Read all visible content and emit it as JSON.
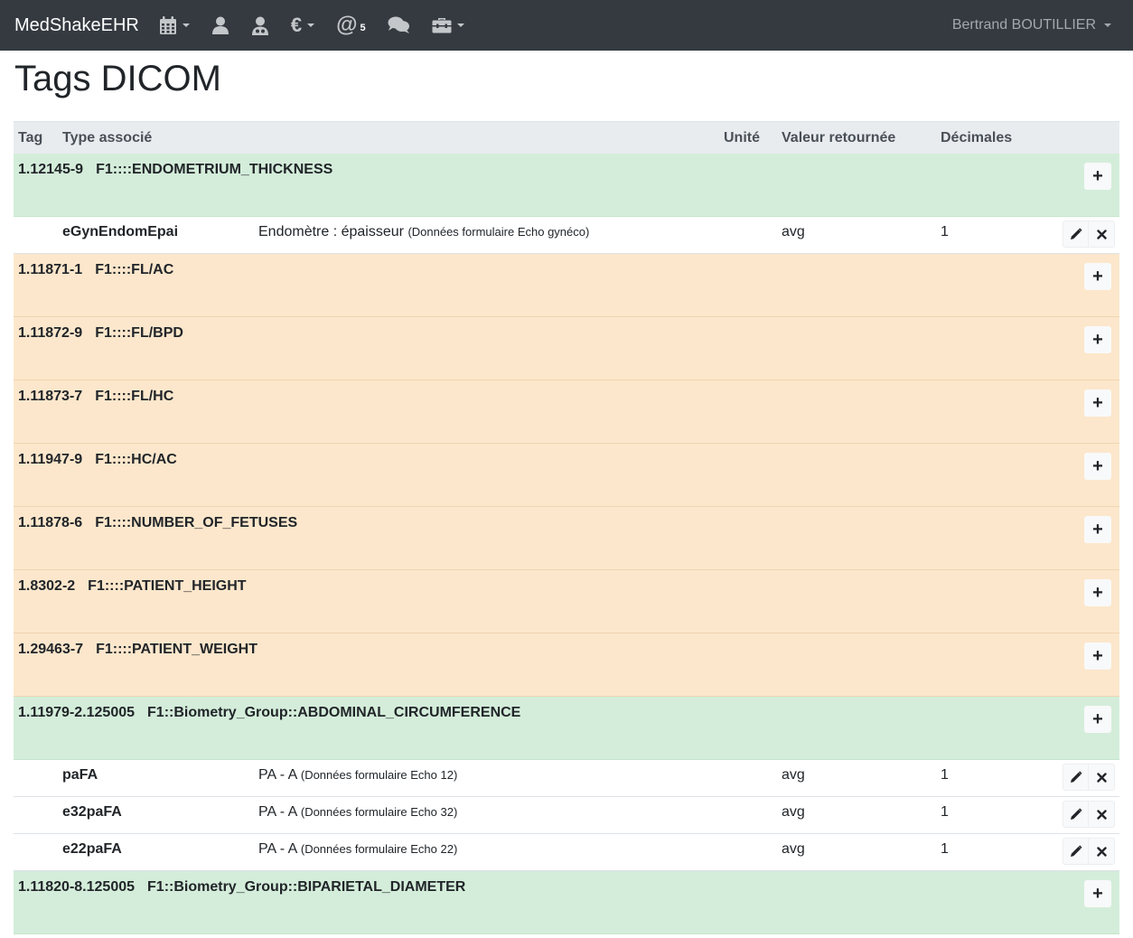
{
  "navbar": {
    "brand": "MedShakeEHR",
    "mail_badge": "5",
    "euro_symbol": "€",
    "at_symbol": "@",
    "user_name": "Bertrand BOUTILLIER"
  },
  "page": {
    "title": "Tags DICOM"
  },
  "table": {
    "headers": {
      "tag": "Tag",
      "type": "Type associé",
      "unite": "Unité",
      "valeur": "Valeur retournée",
      "decimales": "Décimales"
    },
    "add_label": "+",
    "groups": [
      {
        "tag": "1.12145-9",
        "name": "F1::::ENDOMETRIUM_THICKNESS",
        "status": "green",
        "items": [
          {
            "code": "eGynEndomEpai",
            "label": "Endomètre : épaisseur",
            "source": "(Données formulaire Echo gynéco)",
            "valeur": "avg",
            "decimales": "1"
          }
        ]
      },
      {
        "tag": "1.11871-1",
        "name": "F1::::FL/AC",
        "status": "orange",
        "items": []
      },
      {
        "tag": "1.11872-9",
        "name": "F1::::FL/BPD",
        "status": "orange",
        "items": []
      },
      {
        "tag": "1.11873-7",
        "name": "F1::::FL/HC",
        "status": "orange",
        "items": []
      },
      {
        "tag": "1.11947-9",
        "name": "F1::::HC/AC",
        "status": "orange",
        "items": []
      },
      {
        "tag": "1.11878-6",
        "name": "F1::::NUMBER_OF_FETUSES",
        "status": "orange",
        "items": []
      },
      {
        "tag": "1.8302-2",
        "name": "F1::::PATIENT_HEIGHT",
        "status": "orange",
        "items": []
      },
      {
        "tag": "1.29463-7",
        "name": "F1::::PATIENT_WEIGHT",
        "status": "orange",
        "items": []
      },
      {
        "tag": "1.11979-2.125005",
        "name": "F1::Biometry_Group::ABDOMINAL_CIRCUMFERENCE",
        "status": "green",
        "items": [
          {
            "code": "paFA",
            "label": "PA - A",
            "source": "(Données formulaire Echo 12)",
            "valeur": "avg",
            "decimales": "1"
          },
          {
            "code": "e32paFA",
            "label": "PA - A",
            "source": "(Données formulaire Echo 32)",
            "valeur": "avg",
            "decimales": "1"
          },
          {
            "code": "e22paFA",
            "label": "PA - A",
            "source": "(Données formulaire Echo 22)",
            "valeur": "avg",
            "decimales": "1"
          }
        ]
      },
      {
        "tag": "1.11820-8.125005",
        "name": "F1::Biometry_Group::BIPARIETAL_DIAMETER",
        "status": "green",
        "items": []
      }
    ]
  },
  "colors": {
    "navbar_bg": "#343a40",
    "row_green": "#d4edda",
    "row_orange": "#fce7cc",
    "header_bg": "#e9ecef"
  },
  "icons": [
    "calendar-icon",
    "user-icon",
    "doctor-icon",
    "euro-icon",
    "at-icon",
    "comments-icon",
    "toolbox-icon",
    "pencil-icon",
    "times-icon"
  ]
}
